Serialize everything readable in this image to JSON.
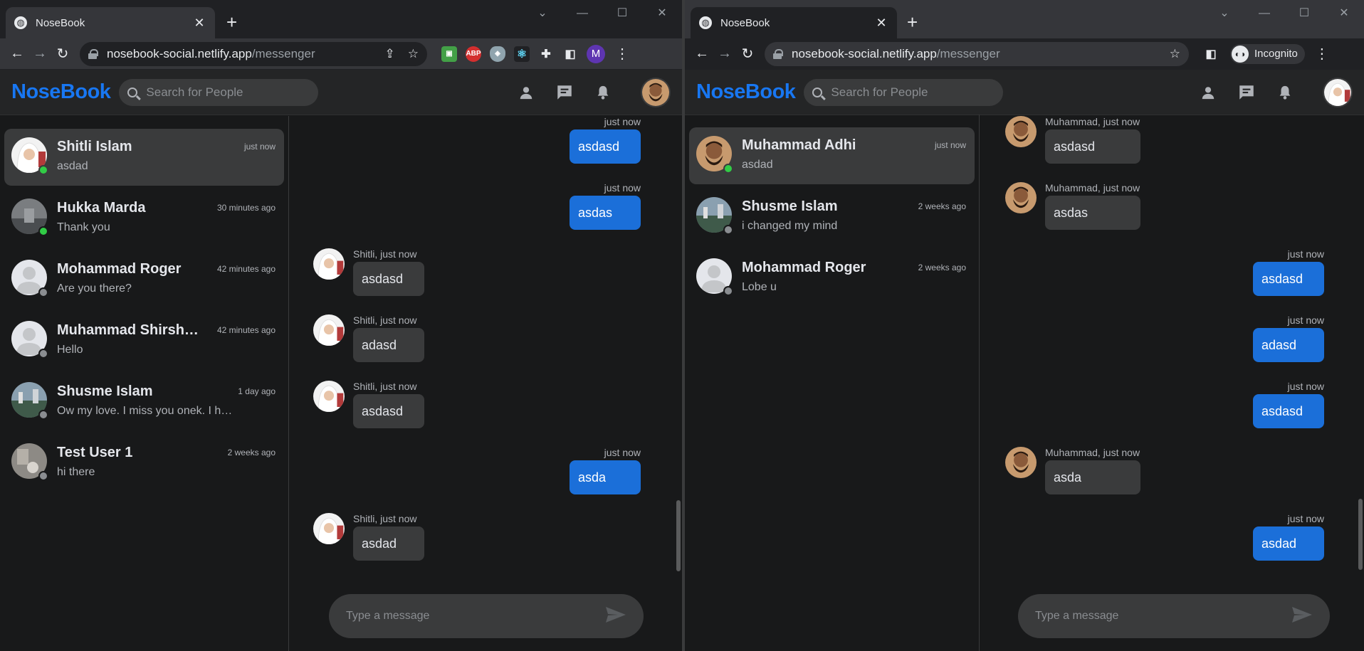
{
  "left": {
    "tab_title": "NoseBook",
    "url_host": "nosebook-social.netlify.app",
    "url_path": "/messenger",
    "profile_initial": "M",
    "app": {
      "logo": "NoseBook",
      "search_placeholder": "Search for People"
    },
    "conversations": [
      {
        "name": "Shitli Islam",
        "time": "just now",
        "last": "asdad",
        "online": true,
        "avatar": "woman-hijab",
        "active": true
      },
      {
        "name": "Hukka Marda",
        "time": "30 minutes ago",
        "last": "Thank you",
        "online": true,
        "avatar": "gray-photo",
        "active": false
      },
      {
        "name": "Mohammad Roger",
        "time": "42 minutes ago",
        "last": "Are you there?",
        "online": false,
        "avatar": "default",
        "active": false
      },
      {
        "name": "Muhammad Shirsho ...",
        "time": "42 minutes ago",
        "last": "Hello",
        "online": false,
        "avatar": "default",
        "active": false
      },
      {
        "name": "Shusme Islam",
        "time": "1 day ago",
        "last": "Ow my love. I miss you onek. I ha...",
        "online": false,
        "avatar": "landscape",
        "active": false
      },
      {
        "name": "Test User 1",
        "time": "2 weeks ago",
        "last": "hi there",
        "online": false,
        "avatar": "room",
        "active": false
      }
    ],
    "messages": [
      {
        "mine": true,
        "meta": "just now",
        "text": "asdasd"
      },
      {
        "mine": true,
        "meta": "just now",
        "text": "asdas"
      },
      {
        "mine": false,
        "meta": "Shitli, just now",
        "text": "asdasd"
      },
      {
        "mine": false,
        "meta": "Shitli, just now",
        "text": "adasd"
      },
      {
        "mine": false,
        "meta": "Shitli, just now",
        "text": "asdasd"
      },
      {
        "mine": true,
        "meta": "just now",
        "text": "asda"
      },
      {
        "mine": false,
        "meta": "Shitli, just now",
        "text": "asdad"
      }
    ],
    "composer_placeholder": "Type a message"
  },
  "right": {
    "tab_title": "NoseBook",
    "url_host": "nosebook-social.netlify.app",
    "url_path": "/messenger",
    "incognito_label": "Incognito",
    "app": {
      "logo": "NoseBook",
      "search_placeholder": "Search for People"
    },
    "conversations": [
      {
        "name": "Muhammad Adhi",
        "time": "just now",
        "last": "asdad",
        "online": true,
        "avatar": "man-beard",
        "active": true
      },
      {
        "name": "Shusme Islam",
        "time": "2 weeks ago",
        "last": "i changed my mind",
        "online": false,
        "avatar": "landscape",
        "active": false
      },
      {
        "name": "Mohammad Roger",
        "time": "2 weeks ago",
        "last": "Lobe u",
        "online": false,
        "avatar": "default",
        "active": false
      }
    ],
    "messages": [
      {
        "mine": false,
        "meta": "Muhammad, just now",
        "text": "asdasd"
      },
      {
        "mine": false,
        "meta": "Muhammad, just now",
        "text": "asdas"
      },
      {
        "mine": true,
        "meta": "just now",
        "text": "asdasd"
      },
      {
        "mine": true,
        "meta": "just now",
        "text": "adasd"
      },
      {
        "mine": true,
        "meta": "just now",
        "text": "asdasd"
      },
      {
        "mine": false,
        "meta": "Muhammad, just now",
        "text": "asda"
      },
      {
        "mine": true,
        "meta": "just now",
        "text": "asdad"
      }
    ],
    "composer_placeholder": "Type a message"
  },
  "colors": {
    "brand": "#1877f2",
    "bubble_mine": "#1b6fd9",
    "bubble_theirs": "#3a3b3c",
    "online": "#31cc46",
    "offline": "#8a8d91"
  }
}
